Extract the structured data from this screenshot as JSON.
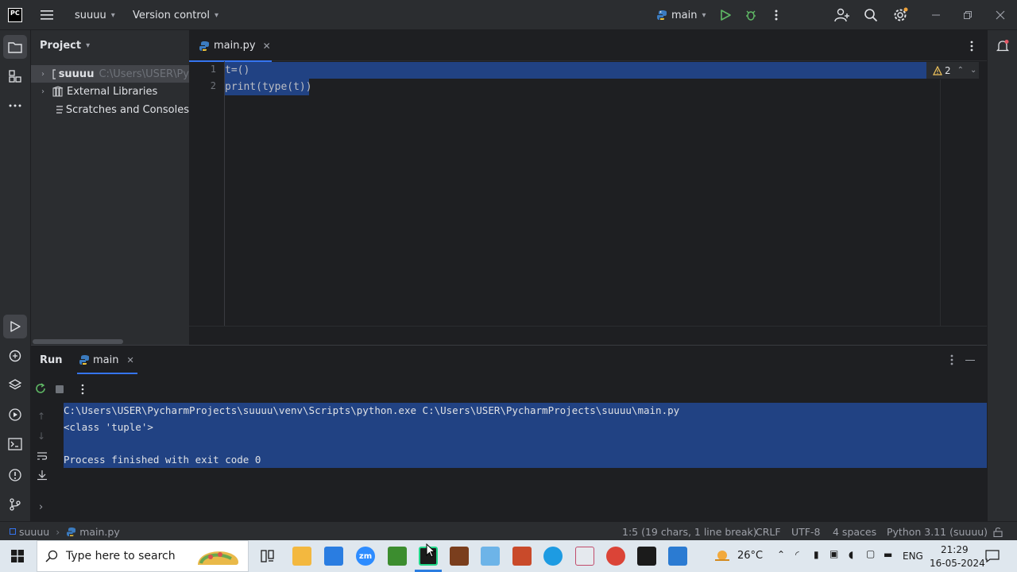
{
  "titlebar": {
    "app_logo": "PC",
    "project_name": "suuuu",
    "vcs_label": "Version control",
    "run_config": "main"
  },
  "project_panel": {
    "title": "Project",
    "items": [
      {
        "label": "suuuu",
        "path": "C:\\Users\\USER\\Py"
      },
      {
        "label": "External Libraries"
      },
      {
        "label": "Scratches and Consoles"
      }
    ]
  },
  "editor": {
    "tab_label": "main.py",
    "lines": [
      "t=()",
      "print(type(t))"
    ],
    "line_numbers": [
      "1",
      "2"
    ],
    "warning_count": "2"
  },
  "run_panel": {
    "title": "Run",
    "tab_label": "main",
    "output": [
      "C:\\Users\\USER\\PycharmProjects\\suuuu\\venv\\Scripts\\python.exe C:\\Users\\USER\\PycharmProjects\\suuuu\\main.py",
      "<class 'tuple'>",
      "",
      "Process finished with exit code 0"
    ]
  },
  "statusbar": {
    "breadcrumb_project": "suuuu",
    "breadcrumb_file": "main.py",
    "position": "1:5 (19 chars, 1 line break)",
    "line_ending": "CRLF",
    "encoding": "UTF-8",
    "indent": "4 spaces",
    "interpreter": "Python 3.11 (suuuu)"
  },
  "taskbar": {
    "search_placeholder": "Type here to search",
    "zoom_label": "zm",
    "temperature": "26°C",
    "language": "ENG",
    "time": "21:29",
    "date": "16-05-2024"
  },
  "colors": {
    "selection": "#214283",
    "accent_blue": "#3574f0",
    "run_green": "#5fb865",
    "ide_bg": "#1e1f22",
    "panel_bg": "#2b2d30"
  }
}
